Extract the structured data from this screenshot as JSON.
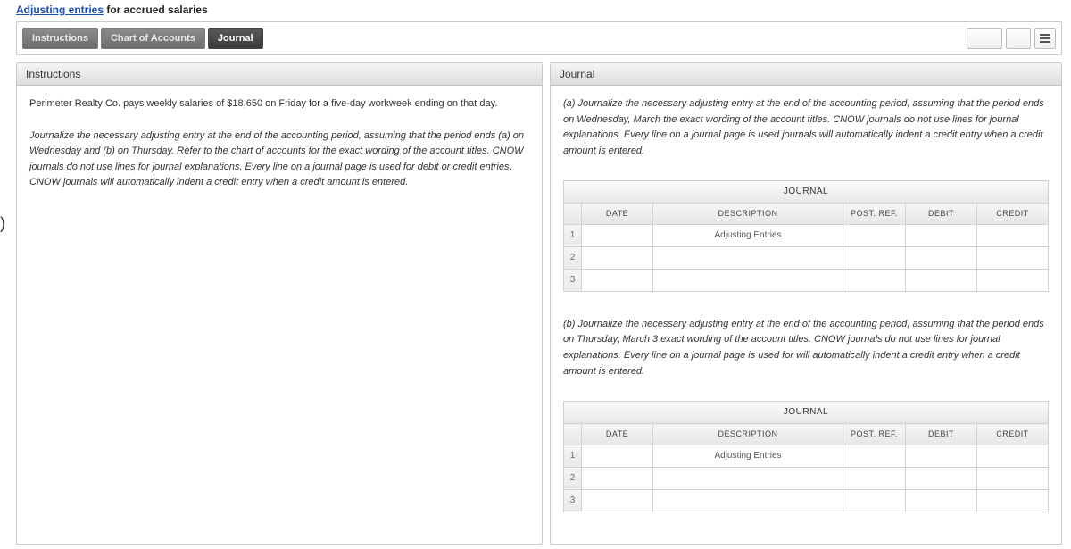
{
  "title": {
    "link": "Adjusting entries",
    "rest": " for accrued salaries"
  },
  "tabs": {
    "instructions": "Instructions",
    "chart": "Chart of Accounts",
    "journal": "Journal"
  },
  "left": {
    "header": "Instructions",
    "p1": "Perimeter Realty Co. pays weekly salaries of $18,650 on Friday for a five-day workweek ending on that day.",
    "p2": "Journalize the necessary adjusting entry at the end of the accounting period, assuming that the period ends (a) on Wednesday and (b) on Thursday. Refer to the chart of accounts for the exact wording of the account titles. CNOW journals do not use lines for journal explanations. Every line on a journal page is used for debit or credit entries. CNOW journals will automatically indent a credit entry when a credit amount is entered."
  },
  "right": {
    "header": "Journal",
    "pa": "(a) Journalize the necessary adjusting entry at the end of the accounting period, assuming that the period ends on Wednesday, March the exact wording of the account titles. CNOW journals do not use lines for journal explanations. Every line on a journal page is used journals will automatically indent a credit entry when a credit amount is entered.",
    "pb": "(b) Journalize the necessary adjusting entry at the end of the accounting period, assuming that the period ends on Thursday, March 3 exact wording of the account titles. CNOW journals do not use lines for journal explanations. Every line on a journal page is used for will automatically indent a credit entry when a credit amount is entered."
  },
  "journal": {
    "title": "JOURNAL",
    "cols": {
      "date": "DATE",
      "desc": "DESCRIPTION",
      "post": "POST. REF.",
      "debit": "DEBIT",
      "credit": "CREDIT"
    },
    "row1desc": "Adjusting Entries",
    "rownums": [
      "1",
      "2",
      "3"
    ]
  }
}
